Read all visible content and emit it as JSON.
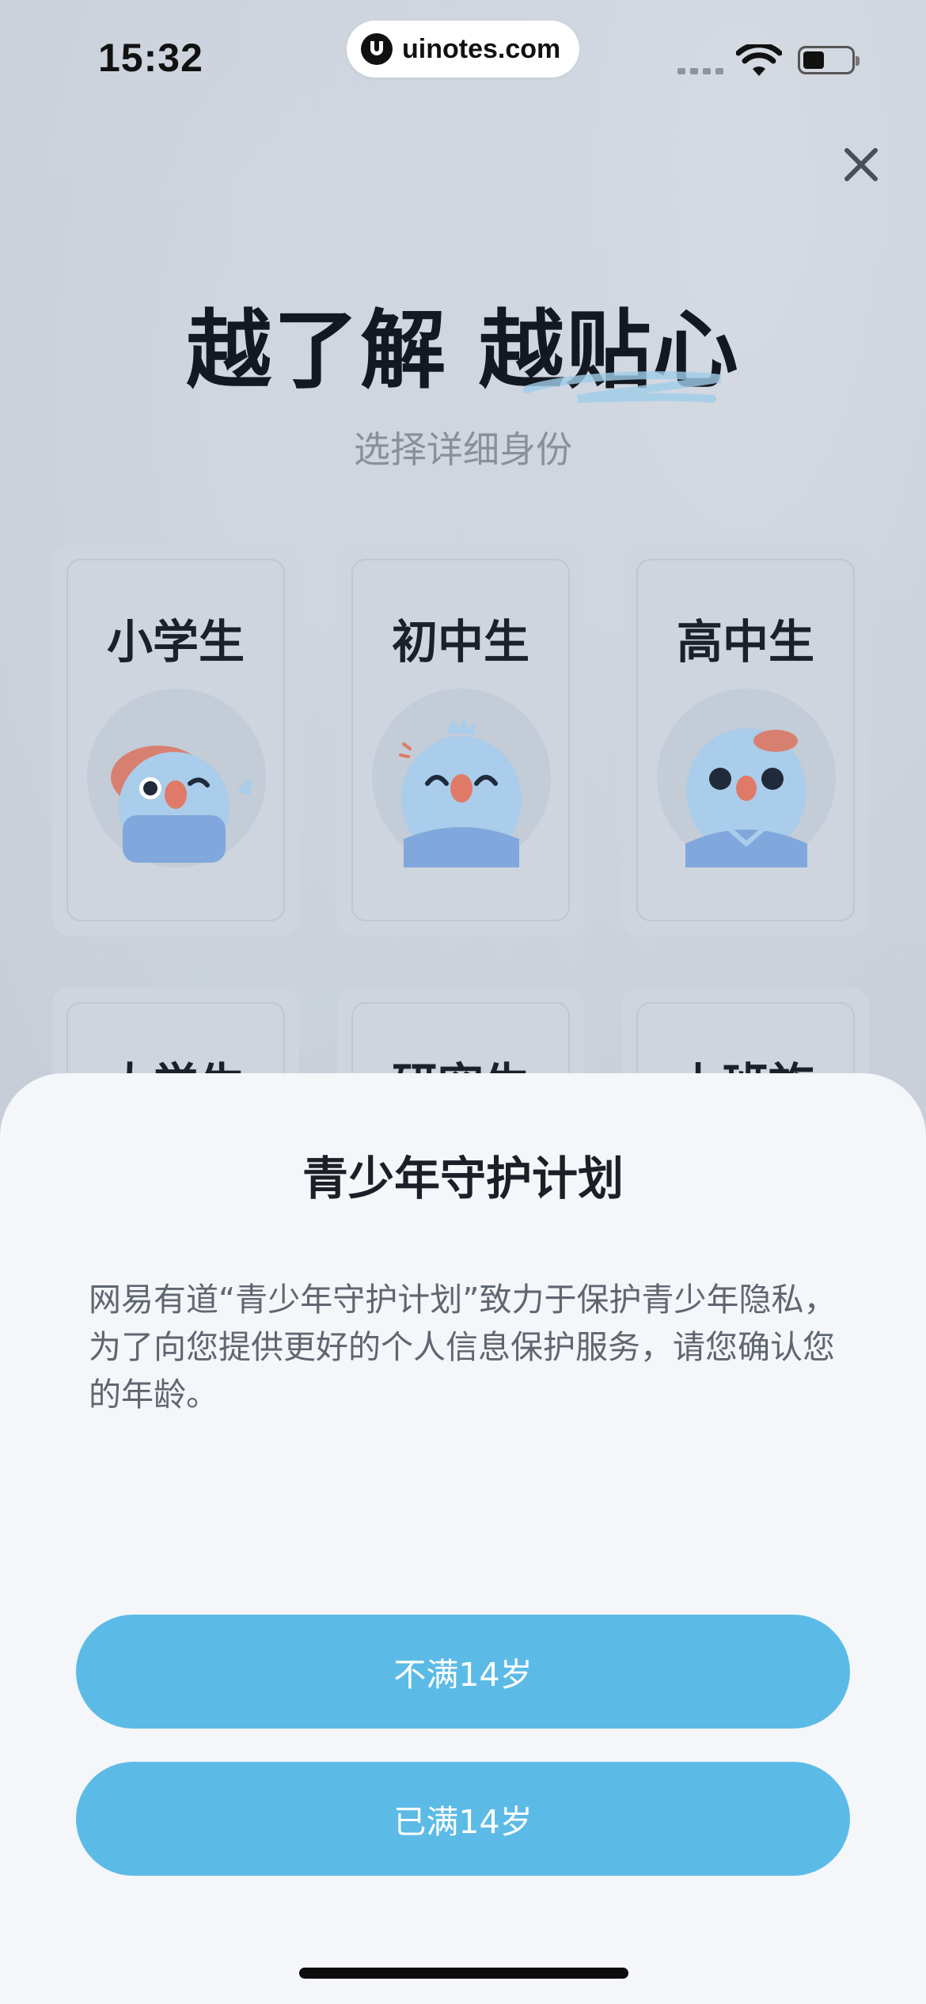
{
  "status_bar": {
    "time": "15:32",
    "url": "uinotes.com"
  },
  "header": {
    "headline": "越了解 越贴心",
    "subtitle": "选择详细身份"
  },
  "identities": [
    {
      "label": "小学生"
    },
    {
      "label": "初中生"
    },
    {
      "label": "高中生"
    },
    {
      "label": "大学生"
    },
    {
      "label": "研究生"
    },
    {
      "label": "上班族"
    }
  ],
  "sheet": {
    "title": "青少年守护计划",
    "body": "网易有道“青少年守护计划”致力于保护青少年隐私，为了向您提供更好的个人信息保护服务，请您确认您的年龄。",
    "under_14_label": "不满14岁",
    "over_14_label": "已满14岁"
  },
  "colors": {
    "accent": "#5cbbe6",
    "background": "#c7ced8",
    "sheet": "#f4f6f9",
    "character_blue": "#a9cdea",
    "character_beak": "#e07a68"
  },
  "icons": [
    "close-icon",
    "wifi-icon",
    "battery-icon",
    "signal-icon"
  ]
}
